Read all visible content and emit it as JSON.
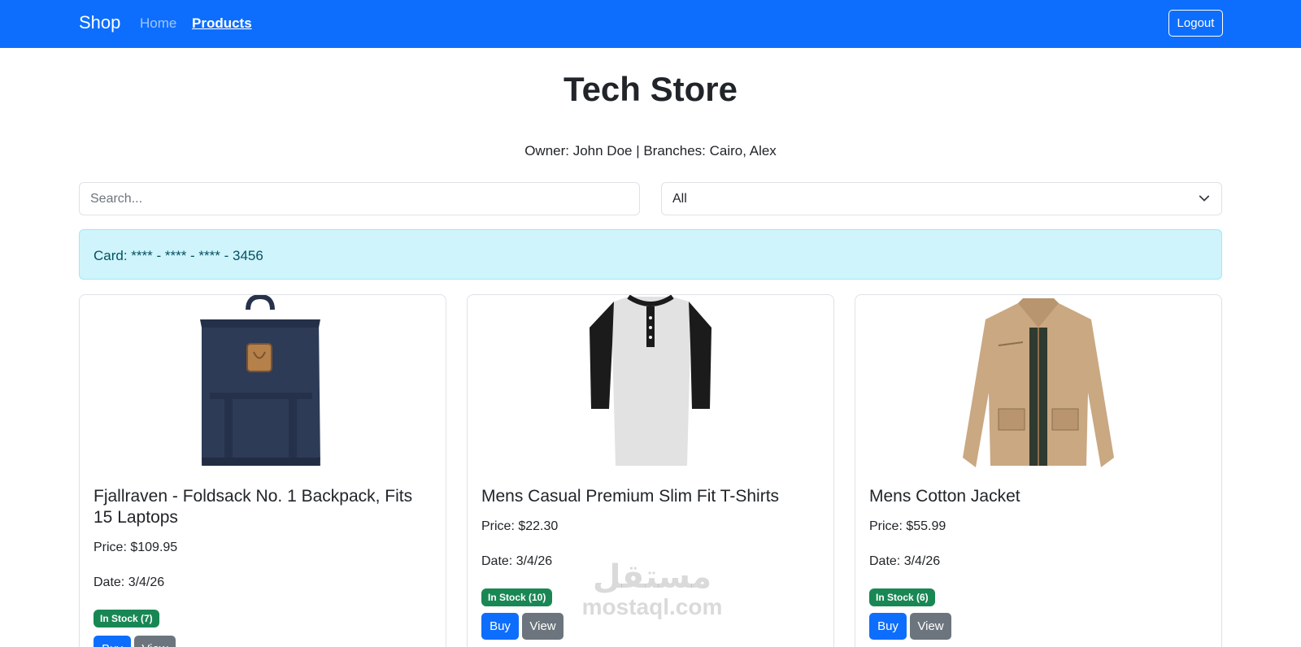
{
  "navbar": {
    "brand": "Shop",
    "links": [
      {
        "label": "Home"
      },
      {
        "label": "Products"
      }
    ],
    "logout_label": "Logout"
  },
  "header": {
    "title": "Tech Store",
    "subtitle": "Owner: John Doe | Branches: Cairo, Alex"
  },
  "filters": {
    "search_placeholder": "Search...",
    "category_selected": "All"
  },
  "alert": {
    "text": "Card: **** - **** - **** - 3456"
  },
  "products": [
    {
      "title": "Fjallraven - Foldsack No. 1 Backpack, Fits 15 Laptops",
      "price": "Price: $109.95",
      "date": "Date: 3/4/26",
      "stock": "In Stock (7)",
      "buy_label": "Buy",
      "view_label": "View",
      "image_icon": "backpack-image"
    },
    {
      "title": "Mens Casual Premium Slim Fit T-Shirts",
      "price": "Price: $22.30",
      "date": "Date: 3/4/26",
      "stock": "In Stock (10)",
      "buy_label": "Buy",
      "view_label": "View",
      "image_icon": "tshirt-image"
    },
    {
      "title": "Mens Cotton Jacket",
      "price": "Price: $55.99",
      "date": "Date: 3/4/26",
      "stock": "In Stock (6)",
      "buy_label": "Buy",
      "view_label": "View",
      "image_icon": "jacket-image"
    }
  ],
  "watermark": {
    "arabic": "مستقل",
    "latin": "mostaql.com"
  },
  "colors": {
    "primary": "#0d6efd",
    "secondary": "#6c757d",
    "success": "#198754",
    "info_bg": "#cff4fc",
    "info_text": "#055160"
  }
}
